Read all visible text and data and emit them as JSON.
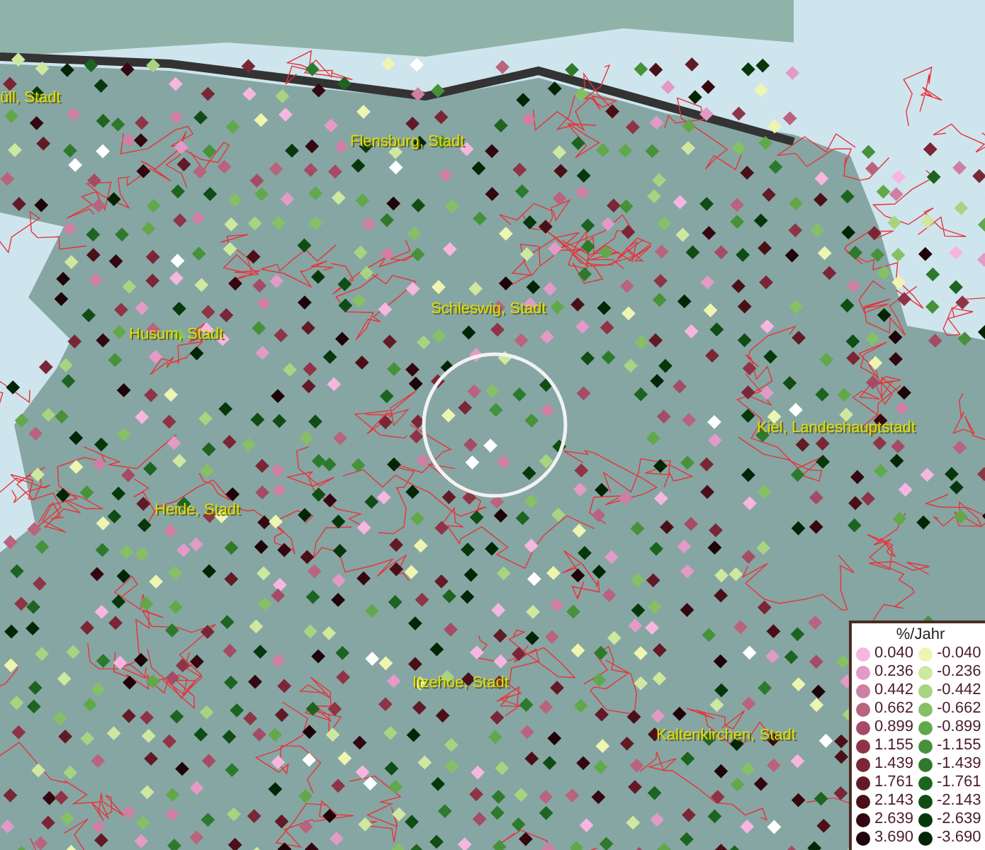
{
  "map": {
    "place_labels": [
      {
        "text": "üll, Stadt"
      },
      {
        "text": "Flensburg, Stadt"
      },
      {
        "text": "Schleswig, Stadt"
      },
      {
        "text": "Husum, Stadt"
      },
      {
        "text": "Kiel, Landeshauptstadt"
      },
      {
        "text": "Heide, Stadt"
      },
      {
        "text": "Itzehoe, Stadt"
      },
      {
        "text": "Kaltenkirchen, Stadt"
      }
    ]
  },
  "legend": {
    "title": "%/Jahr",
    "items": [
      {
        "label": "0.040",
        "color": "#f7b6e0"
      },
      {
        "label": "-0.040",
        "color": "#eef5b0"
      },
      {
        "label": "0.236",
        "color": "#e39ac6"
      },
      {
        "label": "-0.236",
        "color": "#cfe8a0"
      },
      {
        "label": "0.442",
        "color": "#cf7fa4"
      },
      {
        "label": "-0.442",
        "color": "#a8d47f"
      },
      {
        "label": "0.662",
        "color": "#b9637f"
      },
      {
        "label": "-0.662",
        "color": "#86c065"
      },
      {
        "label": "0.899",
        "color": "#a54b66"
      },
      {
        "label": "-0.899",
        "color": "#62a84a"
      },
      {
        "label": "1.155",
        "color": "#8f3447"
      },
      {
        "label": "-1.155",
        "color": "#46913a"
      },
      {
        "label": "1.439",
        "color": "#7a2636"
      },
      {
        "label": "-1.439",
        "color": "#2e7a2c"
      },
      {
        "label": "1.761",
        "color": "#631a27"
      },
      {
        "label": "-1.761",
        "color": "#1d6420"
      },
      {
        "label": "2.143",
        "color": "#4b0f18"
      },
      {
        "label": "-2.143",
        "color": "#0f4d14"
      },
      {
        "label": "2.639",
        "color": "#340810"
      },
      {
        "label": "-2.639",
        "color": "#07380c"
      },
      {
        "label": "3.690",
        "color": "#1e0308"
      },
      {
        "label": "-3.690",
        "color": "#032506"
      }
    ]
  }
}
